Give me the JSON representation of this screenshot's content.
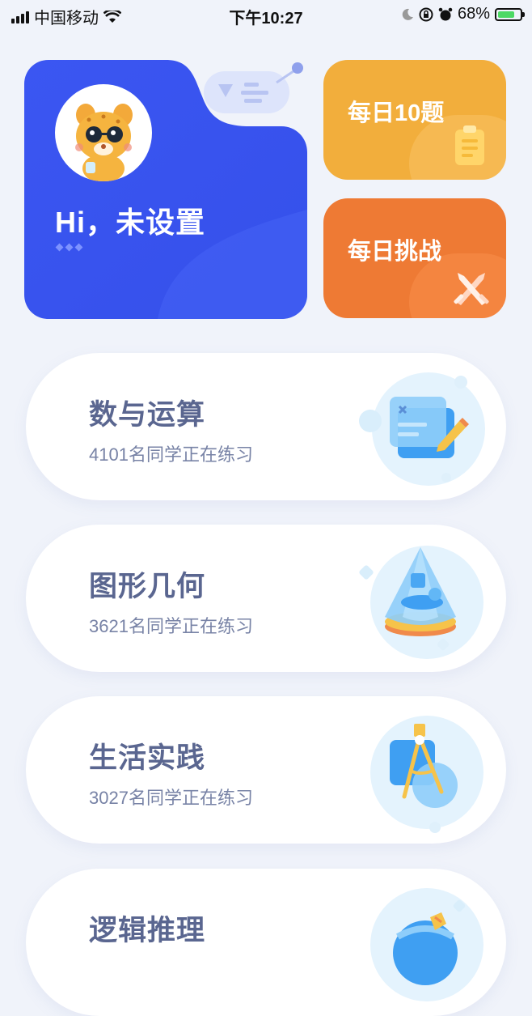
{
  "status_bar": {
    "carrier": "中国移动",
    "time": "下午10:27",
    "battery": "68%"
  },
  "hero": {
    "greeting": "Hi，未设置"
  },
  "quick_cards": [
    {
      "label": "每日10题",
      "color": "#f2ae3c"
    },
    {
      "label": "每日挑战",
      "color": "#ee7a34"
    }
  ],
  "topics": [
    {
      "title": "数与运算",
      "subtitle": "4101名同学正在练习",
      "icon": "calculation-notebook-icon"
    },
    {
      "title": "图形几何",
      "subtitle": "3621名同学正在练习",
      "icon": "geometry-pyramid-icon"
    },
    {
      "title": "生活实践",
      "subtitle": "3027名同学正在练习",
      "icon": "compass-icon"
    },
    {
      "title": "逻辑推理",
      "subtitle": "",
      "icon": "logic-globe-icon"
    }
  ],
  "colors": {
    "background": "#f0f3fa",
    "hero_blue": "#3a57f0",
    "topic_title": "#5a6690"
  }
}
